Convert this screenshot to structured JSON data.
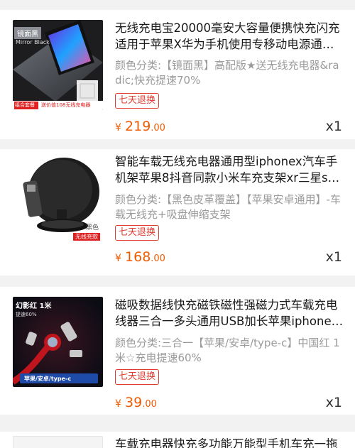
{
  "items": [
    {
      "title": "无线充电宝20000毫安大容量便携快充闪充适用于苹果X华为手机使用专移动电源通用…",
      "spec": "颜色分类:【镜面黑】高配版★送无线充电器&radic;快充提速70%",
      "tag": "七天退换",
      "currency": "¥",
      "price_int": "219",
      "price_dec": ".00",
      "qty": "x1",
      "thumb": {
        "badge": "镜面黑",
        "subtitle": "Mirror Black",
        "promo_left": "组合套餐",
        "promo_right": "送价值108无线充电器"
      }
    },
    {
      "title": "智能车载无线充电器通用型iphonex汽车手机架苹果8抖音同款小米车充支架xr三星s8…",
      "spec": "颜色分类:【黑色皮革覆盖】【苹果安卓通用】-车载无线充+吸盘伸缩支架",
      "tag": "七天退换",
      "currency": "¥",
      "price_int": "168",
      "price_dec": ".00",
      "qty": "x1",
      "thumb": {
        "label_top": "黑色",
        "label_bottom": "无线充款"
      }
    },
    {
      "title": "磁吸数据线快充磁铁磁性强磁力式车载充电线器三合一多头通用USB加长苹果iphone…",
      "spec": "颜色分类:三合一【苹果/安卓/type-c】中国红 1米☆充电提速60%",
      "tag": "七天退换",
      "currency": "¥",
      "price_int": "39",
      "price_dec": ".00",
      "qty": "x1",
      "thumb": {
        "title": "幻影红 1米",
        "subtitle": "提速60%",
        "bottom": "苹果/安卓/type-c"
      }
    },
    {
      "title": "车载充电器快充多功能万能型手机车充一拖"
    }
  ],
  "colors": {
    "price": "#f05a00",
    "tag": "#e03a2f",
    "spec": "#9a9a9a"
  }
}
